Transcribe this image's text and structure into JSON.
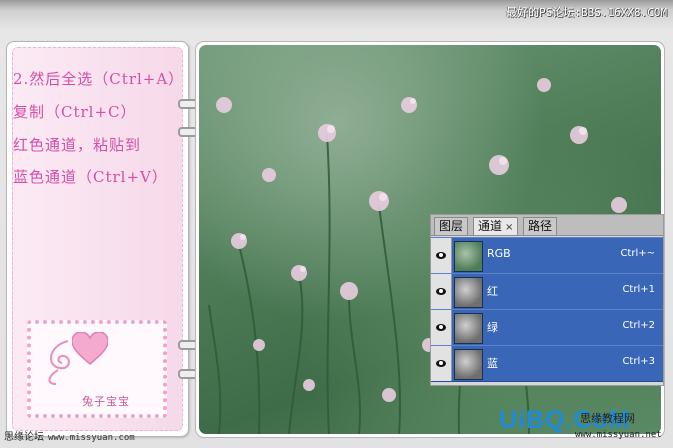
{
  "header": {
    "watermark": "最好的PS论坛:BBS.16XX8.COM"
  },
  "note": {
    "lines": [
      "2.然后全选（Ctrl+A）",
      "复制（Ctrl+C）",
      "红色通道，粘贴到",
      "蓝色通道（Ctrl+V）"
    ],
    "logo_text": "兔子宝宝"
  },
  "panel": {
    "tabs": [
      {
        "label": "图层"
      },
      {
        "label": "通道",
        "close": "×"
      },
      {
        "label": "路径"
      }
    ],
    "channels": [
      {
        "name": "RGB",
        "shortcut": "Ctrl+~"
      },
      {
        "name": "红",
        "shortcut": "Ctrl+1"
      },
      {
        "name": "绿",
        "shortcut": "Ctrl+2"
      },
      {
        "name": "蓝",
        "shortcut": "Ctrl+3"
      }
    ]
  },
  "footer": {
    "left_label": "思缘论坛",
    "left_url": "www.missyuan.com",
    "brand": "UiBQ.CoM",
    "brand_sub": "思缘教程网",
    "brand_url": "www.missyuan.net"
  },
  "colors": {
    "accent_pink": "#d64ea7",
    "channel_selected": "#3a66b8",
    "brand_blue": "#1f8bd8"
  }
}
